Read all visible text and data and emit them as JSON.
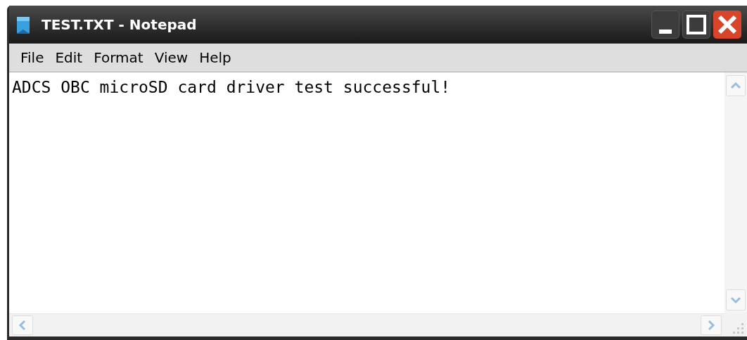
{
  "window": {
    "title": "TEST.TXT - Notepad"
  },
  "menu": [
    "File",
    "Edit",
    "Format",
    "View",
    "Help"
  ],
  "document": {
    "text": "ADCS OBC microSD card driver test successful!"
  }
}
